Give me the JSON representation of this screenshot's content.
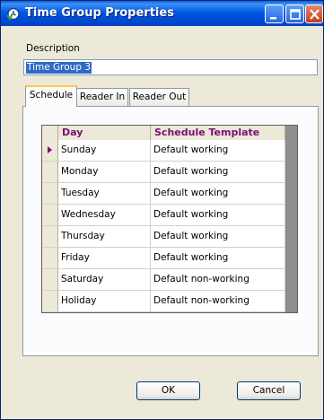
{
  "window": {
    "title": "Time Group Properties",
    "title_icon": "time-group-icon"
  },
  "description": {
    "label": "Description",
    "value": "Time Group 3"
  },
  "tabs": [
    {
      "label": "Schedule",
      "active": true
    },
    {
      "label": "Reader In",
      "active": false
    },
    {
      "label": "Reader Out",
      "active": false
    }
  ],
  "grid": {
    "columns": [
      "Day",
      "Schedule Template"
    ],
    "selected_row_index": 0,
    "rows": [
      {
        "day": "Sunday",
        "template": "Default working"
      },
      {
        "day": "Monday",
        "template": "Default working"
      },
      {
        "day": "Tuesday",
        "template": "Default working"
      },
      {
        "day": "Wednesday",
        "template": "Default working"
      },
      {
        "day": "Thursday",
        "template": "Default working"
      },
      {
        "day": "Friday",
        "template": "Default working"
      },
      {
        "day": "Saturday",
        "template": "Default non-working"
      },
      {
        "day": "Holiday",
        "template": "Default non-working"
      }
    ]
  },
  "buttons": {
    "ok": "OK",
    "cancel": "Cancel"
  },
  "colors": {
    "titlebar": "#0058e4",
    "header_text": "#7a0f74",
    "selection": "#316ac5",
    "tab_highlight": "#ffc83c"
  }
}
